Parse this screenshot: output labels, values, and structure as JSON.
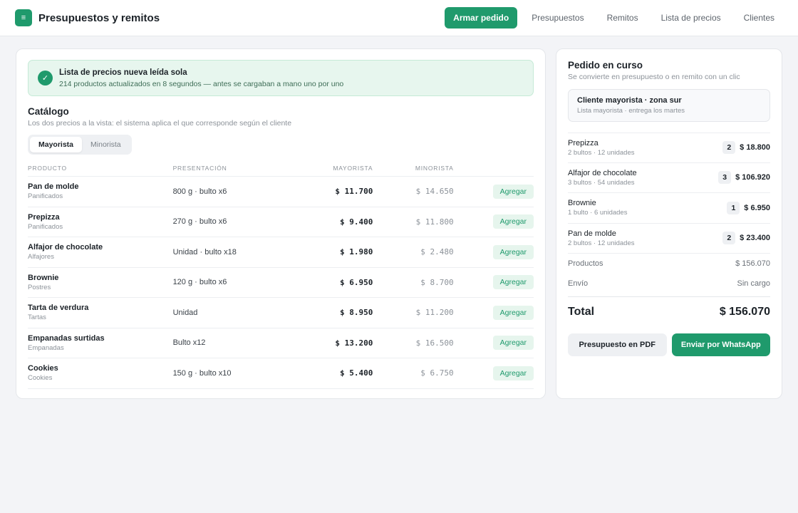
{
  "header": {
    "title": "Presupuestos y remitos",
    "nav": [
      "Armar pedido",
      "Presupuestos",
      "Remitos",
      "Lista de precios",
      "Clientes"
    ]
  },
  "banner": {
    "title": "Lista de precios nueva leída sola",
    "subtitle": "214 productos actualizados en 8 segundos — antes se cargaban a mano uno por uno"
  },
  "catalog": {
    "title": "Catálogo",
    "subtitle": "Los dos precios a la vista: el sistema aplica el que corresponde según el cliente",
    "toggle": [
      "Mayorista",
      "Minorista"
    ],
    "columns": [
      "PRODUCTO",
      "PRESENTACIÓN",
      "MAYORISTA",
      "MINORISTA"
    ],
    "add_label": "Agregar",
    "rows": [
      {
        "name": "Pan de molde",
        "category": "Panificados",
        "presentation": "800 g · bulto x6",
        "wholesale": "$ 11.700",
        "retail": "$ 14.650"
      },
      {
        "name": "Prepizza",
        "category": "Panificados",
        "presentation": "270 g · bulto x6",
        "wholesale": "$ 9.400",
        "retail": "$ 11.800"
      },
      {
        "name": "Alfajor de chocolate",
        "category": "Alfajores",
        "presentation": "Unidad · bulto x18",
        "wholesale": "$ 1.980",
        "retail": "$ 2.480"
      },
      {
        "name": "Brownie",
        "category": "Postres",
        "presentation": "120 g · bulto x6",
        "wholesale": "$ 6.950",
        "retail": "$ 8.700"
      },
      {
        "name": "Tarta de verdura",
        "category": "Tartas",
        "presentation": "Unidad",
        "wholesale": "$ 8.950",
        "retail": "$ 11.200"
      },
      {
        "name": "Empanadas surtidas",
        "category": "Empanadas",
        "presentation": "Bulto x12",
        "wholesale": "$ 13.200",
        "retail": "$ 16.500"
      },
      {
        "name": "Cookies",
        "category": "Cookies",
        "presentation": "150 g · bulto x10",
        "wholesale": "$ 5.400",
        "retail": "$ 6.750"
      }
    ]
  },
  "order": {
    "title": "Pedido en curso",
    "subtitle": "Se convierte en presupuesto o en remito con un clic",
    "client": {
      "name": "Cliente mayorista · zona sur",
      "detail": "Lista mayorista · entrega los martes"
    },
    "items": [
      {
        "name": "Prepizza",
        "detail": "2 bultos · 12 unidades",
        "qty": "2",
        "price": "$ 18.800"
      },
      {
        "name": "Alfajor de chocolate",
        "detail": "3 bultos · 54 unidades",
        "qty": "3",
        "price": "$ 106.920"
      },
      {
        "name": "Brownie",
        "detail": "1 bulto · 6 unidades",
        "qty": "1",
        "price": "$ 6.950"
      },
      {
        "name": "Pan de molde",
        "detail": "2 bultos · 12 unidades",
        "qty": "2",
        "price": "$ 23.400"
      }
    ],
    "products_label": "Productos",
    "products_value": "$ 156.070",
    "shipping_label": "Envío",
    "shipping_value": "Sin cargo",
    "total_label": "Total",
    "total_value": "$ 156.070",
    "pdf_button": "Presupuesto en PDF",
    "whatsapp_button": "Enviar por WhatsApp"
  },
  "colors": {
    "accent": "#1f9a6c",
    "banner_bg": "#e7f6ee"
  },
  "icons": {
    "logo": "menu-icon",
    "banner": "check-icon"
  }
}
